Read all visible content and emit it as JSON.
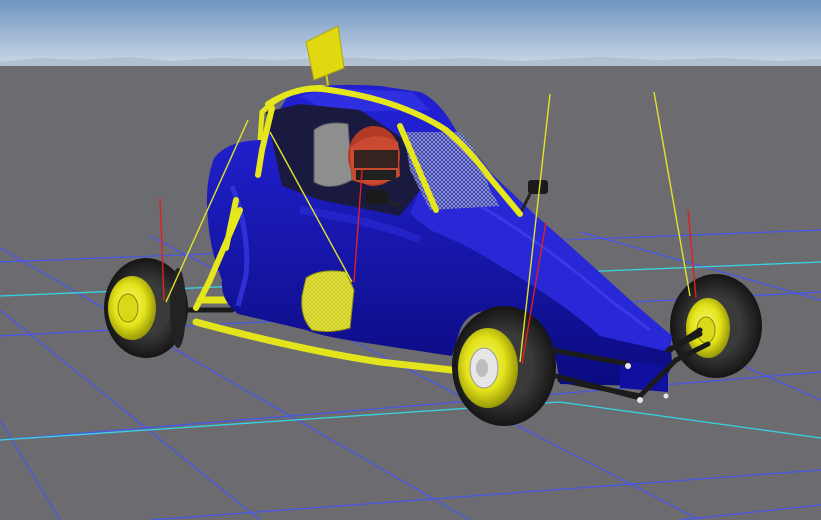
{
  "scene": {
    "description_visible": false,
    "colors": {
      "sky_top": "#6f95c2",
      "sky_bottom": "#c9d7e6",
      "ground": "#6c6c70",
      "grid_major": "#4a5cf0",
      "grid_axis": "#33d6e6",
      "body_blue": "#1414b8",
      "body_highlight": "#3d3df0",
      "body_shadow": "#08086a",
      "frame_yellow": "#e6e61a",
      "wheel_rim": "#e8e81e",
      "tire": "#2a2a2a",
      "force_red": "#e02020",
      "force_yellow": "#e0e020",
      "helmet_red": "#c43a22",
      "seat_gray": "#9a9a9a"
    }
  }
}
